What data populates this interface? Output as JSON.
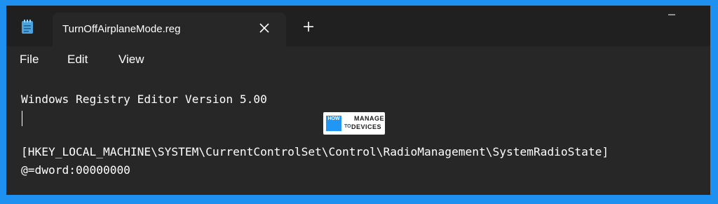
{
  "tab": {
    "title": "TurnOffAirplaneMode.reg"
  },
  "menu": {
    "items": [
      "File",
      "Edit",
      "View"
    ]
  },
  "editor": {
    "lines": [
      "Windows Registry Editor Version 5.00",
      "",
      "",
      "[HKEY_LOCAL_MACHINE\\SYSTEM\\CurrentControlSet\\Control\\RadioManagement\\SystemRadioState]",
      "@=dword:00000000"
    ]
  },
  "watermark": {
    "how": "HOW",
    "to": "TO",
    "manage": "MANAGE",
    "devices": "DEVICES"
  },
  "icons": {
    "app": "notepad-icon",
    "close": "close-icon",
    "new_tab": "plus-icon",
    "minimize": "minimize-icon"
  },
  "colors": {
    "background": "#1e90f0",
    "window": "#272727",
    "titlebar": "#202020"
  }
}
